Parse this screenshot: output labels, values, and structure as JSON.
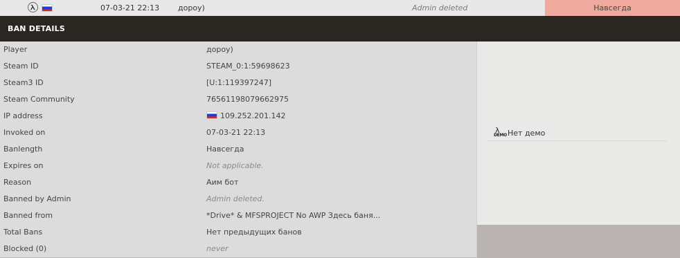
{
  "ban_row": {
    "mod_icon": "half-life-lambda-icon",
    "country_flag": "russia-flag-icon",
    "date": "07-03-21 22:13",
    "player_name": "дороу)",
    "admin": "Admin deleted",
    "length": "Навсегда",
    "length_color": "#f0a99d"
  },
  "header": {
    "title": "BAN DETAILS",
    "background": "#2a2723"
  },
  "details": [
    {
      "label": "Player",
      "value": "дороу)",
      "muted": false
    },
    {
      "label": "Steam ID",
      "value": "STEAM_0:1:59698623",
      "muted": false
    },
    {
      "label": "Steam3 ID",
      "value": "[U:1:119397247]",
      "muted": false
    },
    {
      "label": "Steam Community",
      "value": "76561198079662975",
      "muted": false
    },
    {
      "label": "IP address",
      "value": "109.252.201.142",
      "muted": false,
      "flag": "russia-flag-icon"
    },
    {
      "label": "Invoked on",
      "value": "07-03-21 22:13",
      "muted": false
    },
    {
      "label": "Banlength",
      "value": "Навсегда",
      "muted": false
    },
    {
      "label": "Expires on",
      "value": "Not applicable.",
      "muted": true
    },
    {
      "label": "Reason",
      "value": "Аим бот",
      "muted": false
    },
    {
      "label": "Banned by Admin",
      "value": "Admin deleted.",
      "muted": true
    },
    {
      "label": "Banned from",
      "value": "*Drive* & MFSPROJECT No AWP Здесь баня...",
      "muted": false
    },
    {
      "label": "Total Bans",
      "value": "Нет предыдущих банов",
      "muted": false
    },
    {
      "label": "Blocked (0)",
      "value": "never",
      "muted": true
    }
  ],
  "demo": {
    "icon": "demo-icon",
    "icon_text": "DEMO",
    "label": "Нет демо"
  }
}
